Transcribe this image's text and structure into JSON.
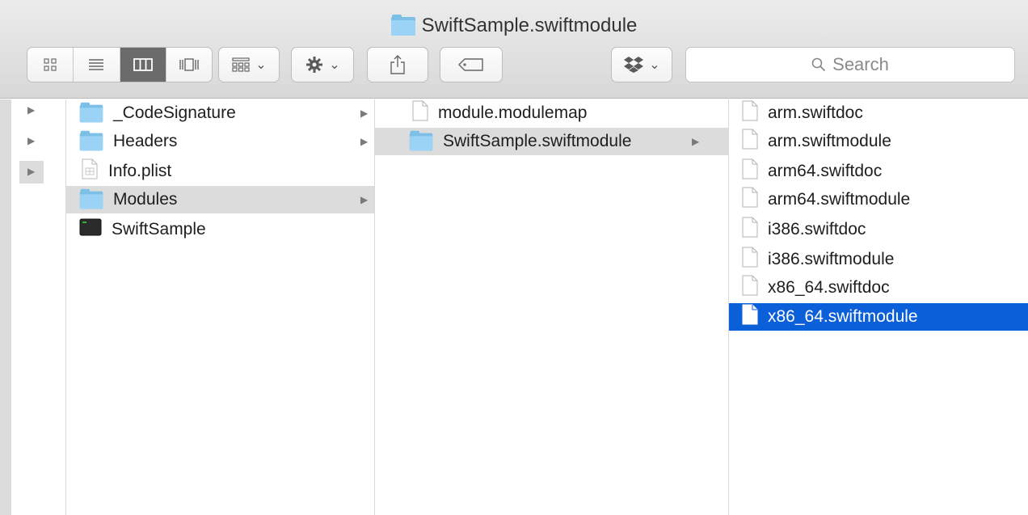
{
  "window": {
    "title": "SwiftSample.swiftmodule"
  },
  "toolbar": {
    "view_icons": [
      "grid-icon",
      "list-icon",
      "columns-icon",
      "coverflow-icon"
    ],
    "arrange_icon": "arrange-icon",
    "action_icon": "gear-icon",
    "share_icon": "share-icon",
    "tag_icon": "tag-icon",
    "dropbox_icon": "dropbox-icon",
    "search_placeholder": "Search",
    "chevron": "⌄"
  },
  "columns": [
    {
      "name": "parent",
      "items": [
        {
          "label": "_CodeSignature",
          "kind": "folder",
          "has_children": true
        },
        {
          "label": "Headers",
          "kind": "folder",
          "has_children": true
        },
        {
          "label": "Info.plist",
          "kind": "plist",
          "has_children": false
        },
        {
          "label": "Modules",
          "kind": "folder",
          "has_children": true,
          "selected": true
        },
        {
          "label": "SwiftSample",
          "kind": "executable",
          "has_children": false
        }
      ]
    },
    {
      "name": "modules",
      "items": [
        {
          "label": "module.modulemap",
          "kind": "document",
          "has_children": false
        },
        {
          "label": "SwiftSample.swiftmodule",
          "kind": "folder",
          "has_children": true,
          "selected": true
        }
      ]
    },
    {
      "name": "swiftmodule",
      "items": [
        {
          "label": "arm.swiftdoc",
          "kind": "document"
        },
        {
          "label": "arm.swiftmodule",
          "kind": "document"
        },
        {
          "label": "arm64.swiftdoc",
          "kind": "document"
        },
        {
          "label": "arm64.swiftmodule",
          "kind": "document"
        },
        {
          "label": "i386.swiftdoc",
          "kind": "document"
        },
        {
          "label": "i386.swiftmodule",
          "kind": "document"
        },
        {
          "label": "x86_64.swiftdoc",
          "kind": "document"
        },
        {
          "label": "x86_64.swiftmodule",
          "kind": "document",
          "selected": true
        }
      ]
    }
  ],
  "colors": {
    "selection_blue": "#0b5fd8",
    "selection_gray": "#dcdcdc",
    "folder": "#9ad3f5"
  }
}
